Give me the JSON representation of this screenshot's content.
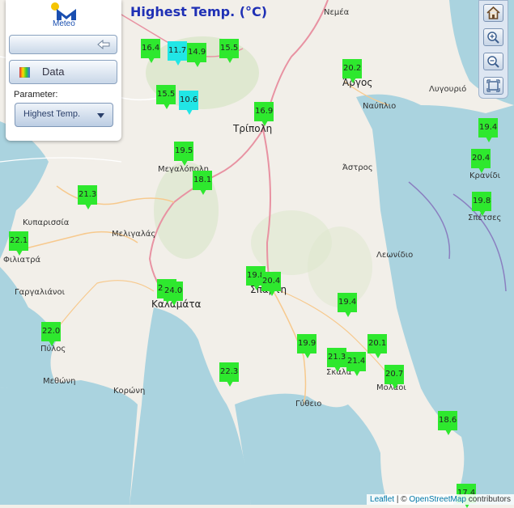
{
  "app": {
    "logo_text": "Meteo",
    "title": "Highest Temp. (°C)"
  },
  "panel": {
    "data_label": "Data",
    "parameter_label": "Parameter:",
    "parameter_value": "Highest Temp."
  },
  "attribution": {
    "leaflet": "Leaflet",
    "separator": " | © ",
    "osm": "OpenStreetMap",
    "suffix": " contributors"
  },
  "colors": {
    "marker_green": "#2ee82e",
    "marker_cyan": "#21e6e6",
    "title": "#1f30b5",
    "land": "#f2efe9",
    "sea": "#aad3df"
  },
  "places": [
    "Νεμέα",
    "Άργος",
    "Ναύπλιο",
    "Λυγουριό",
    "Τρίπολη",
    "Μεγαλόπολη",
    "Άστρος",
    "Κρανίδι",
    "Σπέτσες",
    "Κυπαρισσία",
    "Μελιγαλάς",
    "Φιλιατρά",
    "Γαργαλιάνοι",
    "Λεωνίδιο",
    "Καλαμάτα",
    "Σπάρτη",
    "Πύλος",
    "Μεθώνη",
    "Κορώνη",
    "Σκάλα",
    "Μολάοι",
    "Γύθειο"
  ],
  "stations": [
    {
      "value": "16.4",
      "color": "green"
    },
    {
      "value": "11.7",
      "color": "cyan"
    },
    {
      "value": "14.9",
      "color": "green"
    },
    {
      "value": "15.5",
      "color": "green"
    },
    {
      "value": "20.2",
      "color": "green"
    },
    {
      "value": "15.5",
      "color": "green"
    },
    {
      "value": "10.6",
      "color": "cyan"
    },
    {
      "value": "16.9",
      "color": "green"
    },
    {
      "value": "19.4",
      "color": "green"
    },
    {
      "value": "19.5",
      "color": "green"
    },
    {
      "value": "18.1",
      "color": "green"
    },
    {
      "value": "20.4",
      "color": "green"
    },
    {
      "value": "21.3",
      "color": "green"
    },
    {
      "value": "19.8",
      "color": "green"
    },
    {
      "value": "22.1",
      "color": "green"
    },
    {
      "value": "19.8",
      "color": "green"
    },
    {
      "value": "20.4",
      "color": "green"
    },
    {
      "value": "24.3",
      "color": "green"
    },
    {
      "value": "24.0",
      "color": "green"
    },
    {
      "value": "19.4",
      "color": "green"
    },
    {
      "value": "22.0",
      "color": "green"
    },
    {
      "value": "19.9",
      "color": "green"
    },
    {
      "value": "20.1",
      "color": "green"
    },
    {
      "value": "21.3",
      "color": "green"
    },
    {
      "value": "21.4",
      "color": "green"
    },
    {
      "value": "22.3",
      "color": "green"
    },
    {
      "value": "20.7",
      "color": "green"
    },
    {
      "value": "18.6",
      "color": "green"
    },
    {
      "value": "17.4",
      "color": "green"
    }
  ]
}
